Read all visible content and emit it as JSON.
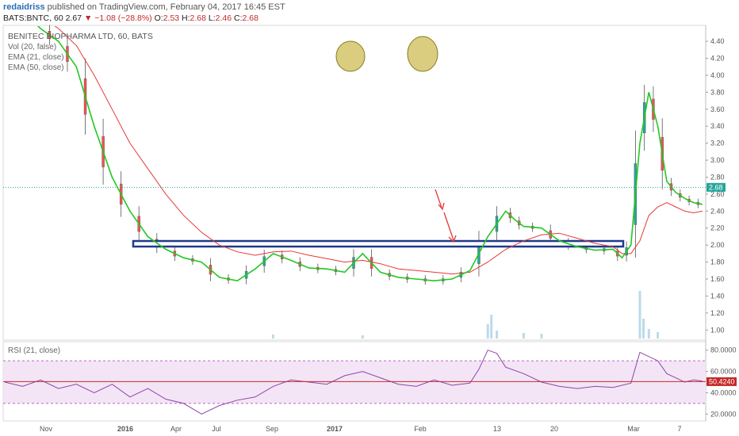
{
  "header": {
    "author": "redaidriss",
    "published_text": "published on TradingView.com, February 04, 2017 16:45 EST",
    "symbol": "BATS:BNTC, 60",
    "last": "2.67",
    "arrow": "▼",
    "change": "−1.08 (−28.8%)",
    "o_label": "O:",
    "o_val": "2.53",
    "h_label": "H:",
    "h_val": "2.68",
    "l_label": "L:",
    "l_val": "2.46",
    "c_label": "C:",
    "c_val": "2.68"
  },
  "legend": {
    "title": "BENITEC BIOPHARMA LTD, 60, BATS",
    "vol": "Vol (20, false)",
    "ema21": "EMA (21, close)",
    "ema50": "EMA (50, close)"
  },
  "rsi_label": "RSI (21, close)",
  "current_price_label": "2.68",
  "rsi_value_label": "50.4240",
  "colors": {
    "ema21": "#22c822",
    "ema50": "#e53935",
    "candle_up": "#26a69a",
    "candle_down": "#ef5350",
    "support_box": "#1e3a8a",
    "rsi_line": "#8e44ad",
    "rsi_band": "#f3e5f5",
    "highlight": "#d4c46a",
    "arrow": "#e53935",
    "volume": "#9ecae1"
  },
  "chart_data": {
    "type": "line",
    "price_axis": {
      "ticks": [
        "4.40",
        "4.20",
        "4.00",
        "3.80",
        "3.60",
        "3.40",
        "3.20",
        "3.00",
        "2.80",
        "2.60",
        "2.40",
        "2.20",
        "2.00",
        "1.80",
        "1.60",
        "1.40",
        "1.20",
        "1.00"
      ],
      "range": [
        0.9,
        4.55
      ]
    },
    "rsi_axis": {
      "ticks": [
        "80.0000",
        "60.0000",
        "40.0000",
        "20.0000"
      ],
      "range": [
        15,
        85
      ],
      "bands": [
        30,
        70
      ]
    },
    "x_ticks": [
      "Nov",
      "2016",
      "Apr",
      "Jul",
      "Sep",
      "2017",
      "Feb",
      "13",
      "20",
      "Mar",
      "7"
    ],
    "support_level": 2.02,
    "current_price": 2.68,
    "rsi_current": 50.424,
    "series": [
      {
        "name": "EMA (21, close)",
        "x": [
          0,
          2,
          4,
          6,
          8,
          10,
          12,
          14,
          16,
          18,
          20,
          22,
          24,
          26,
          28,
          30,
          32,
          34,
          36,
          38,
          40,
          42,
          44,
          46,
          48,
          50,
          52,
          54,
          56,
          57,
          58,
          60,
          62,
          64,
          66,
          68,
          69,
          70,
          71,
          72,
          73,
          74,
          75,
          76,
          77,
          78
        ],
        "y": [
          4.9,
          4.75,
          4.55,
          4.4,
          4.1,
          3.4,
          2.8,
          2.4,
          2.1,
          1.95,
          1.85,
          1.8,
          1.62,
          1.58,
          1.72,
          1.9,
          1.82,
          1.73,
          1.72,
          1.68,
          1.9,
          1.68,
          1.62,
          1.6,
          1.58,
          1.6,
          1.7,
          2.1,
          2.4,
          2.3,
          2.22,
          2.2,
          2.05,
          1.98,
          1.94,
          1.95,
          1.85,
          2.0,
          3.2,
          3.8,
          3.4,
          2.75,
          2.62,
          2.55,
          2.5,
          2.48
        ]
      },
      {
        "name": "EMA (50, close)",
        "x": [
          0,
          2,
          4,
          6,
          8,
          10,
          12,
          14,
          16,
          18,
          20,
          22,
          24,
          26,
          28,
          30,
          32,
          34,
          36,
          38,
          40,
          42,
          44,
          46,
          48,
          50,
          52,
          54,
          56,
          58,
          60,
          62,
          64,
          66,
          68,
          69,
          70,
          71,
          72,
          73,
          74,
          75,
          76,
          77,
          78
        ],
        "y": [
          4.85,
          4.8,
          4.7,
          4.55,
          4.35,
          4.0,
          3.6,
          3.2,
          2.9,
          2.6,
          2.35,
          2.15,
          2.0,
          1.92,
          1.88,
          1.92,
          1.93,
          1.88,
          1.84,
          1.8,
          1.82,
          1.78,
          1.72,
          1.7,
          1.68,
          1.66,
          1.68,
          1.8,
          1.95,
          2.05,
          2.12,
          2.14,
          2.08,
          2.02,
          1.98,
          1.9,
          1.9,
          2.05,
          2.35,
          2.45,
          2.5,
          2.45,
          2.4,
          2.38,
          2.4
        ]
      },
      {
        "name": "RSI (21, close)",
        "x": [
          0,
          2,
          4,
          6,
          8,
          10,
          12,
          14,
          16,
          18,
          20,
          22,
          24,
          26,
          28,
          30,
          32,
          34,
          36,
          38,
          40,
          42,
          44,
          46,
          48,
          50,
          52,
          53,
          54,
          55,
          56,
          58,
          60,
          62,
          64,
          66,
          68,
          70,
          71,
          72,
          73,
          74,
          75,
          76,
          77,
          78
        ],
        "y": [
          50,
          46,
          52,
          44,
          48,
          40,
          48,
          36,
          44,
          34,
          30,
          20,
          28,
          33,
          36,
          46,
          52,
          50,
          48,
          56,
          60,
          54,
          48,
          46,
          52,
          47,
          49,
          62,
          80,
          77,
          64,
          58,
          50,
          46,
          44,
          46,
          45,
          49,
          78,
          74,
          70,
          58,
          54,
          50,
          52,
          51
        ]
      }
    ],
    "annotations": [
      "support zone near 2.00",
      "two spike highs circled near 4.40",
      "red arrows projecting down to 2.00"
    ]
  }
}
